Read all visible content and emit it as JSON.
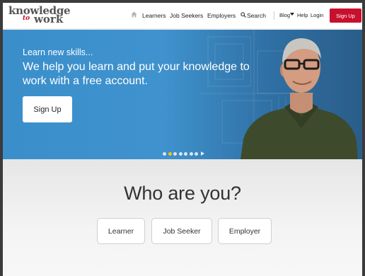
{
  "header": {
    "logo_line1": "knowledge",
    "logo_to": "to",
    "logo_line2": "work",
    "nav": {
      "home_icon": "home-icon",
      "learners": "Learners",
      "job_seekers": "Job Seekers",
      "employers": "Employers",
      "search": "Search",
      "search_icon": "search-icon",
      "blog": "Blog",
      "help": "Help",
      "login": "Login"
    },
    "signup_label": "Sign Up",
    "signup_color": "#c8102e"
  },
  "hero": {
    "kicker": "Learn new skills...",
    "headline": "We help you learn and put your knowledge to work with a free account.",
    "signup_label": "Sign Up",
    "background_color": "#3f92cd",
    "carousel": {
      "slide_count": 7,
      "active_index": 1,
      "active_color": "#f2c318"
    }
  },
  "who": {
    "title": "Who are you?",
    "roles": [
      "Learner",
      "Job Seeker",
      "Employer"
    ]
  }
}
